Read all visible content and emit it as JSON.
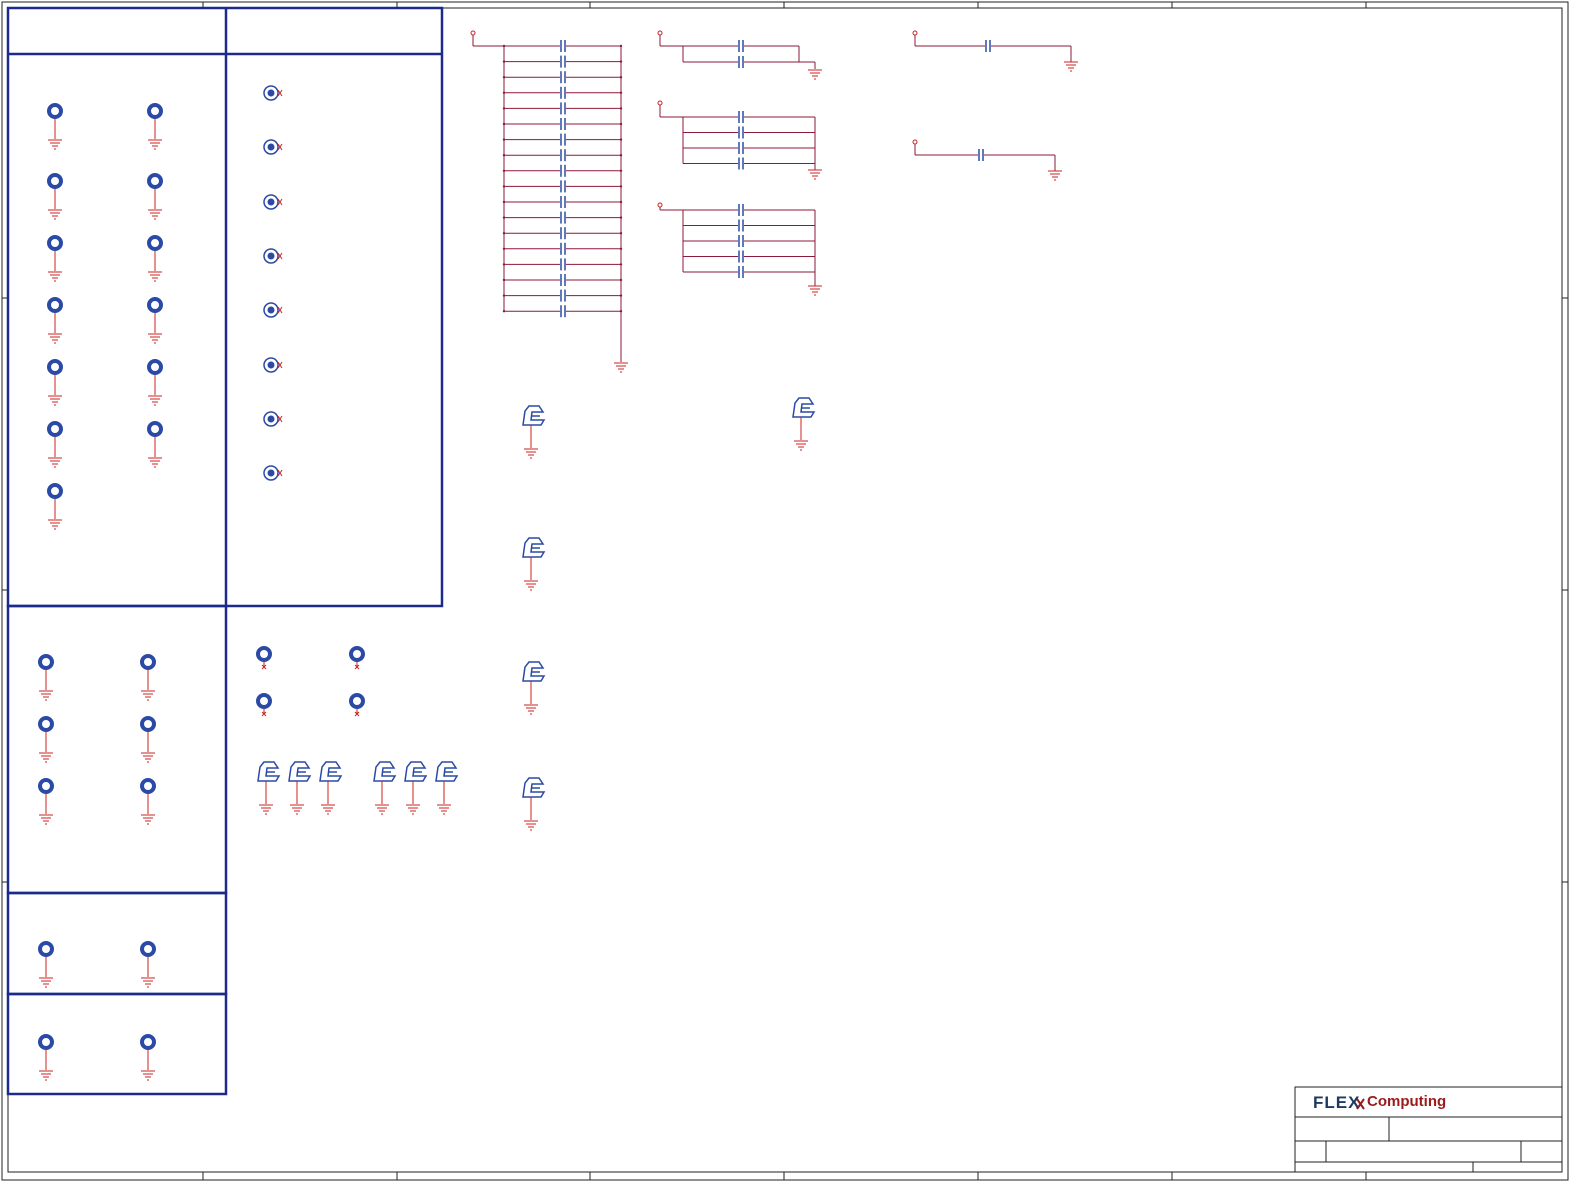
{
  "sheet": {
    "colors": {
      "border": "#222222",
      "frame": "#1c2a8c",
      "wire": "#8b1a3a",
      "pin": "#cc2222",
      "component": "#2b4aa6",
      "ground": "#cc2222"
    }
  },
  "title_block": {
    "logo": {
      "brand": "FLEX",
      "suffix": "Computing"
    }
  },
  "icons": {
    "mounting_hole": "mounting-hole-icon",
    "test_point": "test-point-icon",
    "capacitor": "capacitor-icon",
    "ground": "ground-icon",
    "power_port": "power-port-icon",
    "clip": "emi-clip-icon"
  }
}
